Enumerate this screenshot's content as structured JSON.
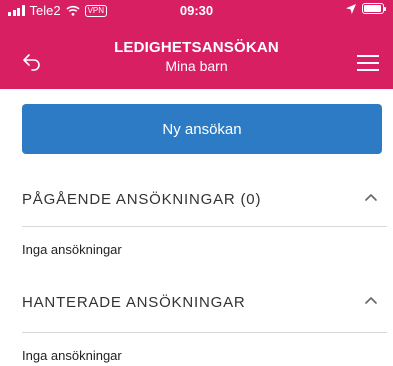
{
  "status_bar": {
    "carrier": "Tele2",
    "vpn": "VPN",
    "time": "09:30",
    "battery_level": 0.95
  },
  "header": {
    "title": "LEDIGHETSANSÖKAN",
    "subtitle": "Mina barn",
    "back_icon": "back-arrow-icon",
    "menu_icon": "hamburger-menu-icon",
    "background": "#d81f62"
  },
  "new_application": {
    "label": "Ny ansökan",
    "color": "#2d7bc4"
  },
  "sections": [
    {
      "title": "PÅGÅENDE ANSÖKNINGAR (0)",
      "empty_text": "Inga ansökningar",
      "expanded": true
    },
    {
      "title": "HANTERADE ANSÖKNINGAR",
      "empty_text": "Inga ansökningar",
      "expanded": true
    }
  ]
}
